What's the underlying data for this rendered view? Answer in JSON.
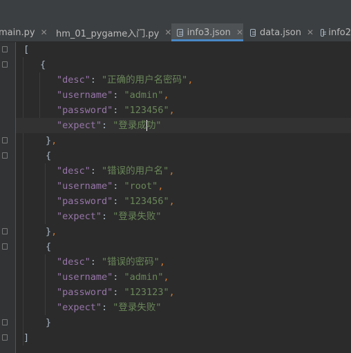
{
  "tabs": [
    {
      "label": "main.py",
      "icon": "python-file-icon",
      "active": false
    },
    {
      "label": "hm_01_pygame入门.py",
      "icon": "python-file-icon",
      "active": false
    },
    {
      "label": "info3.json",
      "icon": "json-file-icon",
      "active": true
    },
    {
      "label": "data.json",
      "icon": "json-file-icon",
      "active": false
    },
    {
      "label": "info2",
      "icon": "json-file-icon",
      "active": false
    }
  ],
  "code": {
    "records": [
      {
        "desc_key": "\"desc\"",
        "desc": "\"正确的用户名密码\"",
        "username_key": "\"username\"",
        "username": "\"admin\"",
        "password_key": "\"password\"",
        "password": "\"123456\"",
        "expect_key": "\"expect\"",
        "expect_a": "\"登录成",
        "expect_b": "功\""
      },
      {
        "desc_key": "\"desc\"",
        "desc": "\"错误的用户名\"",
        "username_key": "\"username\"",
        "username": "\"root\"",
        "password_key": "\"password\"",
        "password": "\"123456\"",
        "expect_key": "\"expect\"",
        "expect": "\"登录失败\""
      },
      {
        "desc_key": "\"desc\"",
        "desc": "\"错误的密码\"",
        "username_key": "\"username\"",
        "username": "\"admin\"",
        "password_key": "\"password\"",
        "password": "\"123123\"",
        "expect_key": "\"expect\"",
        "expect": "\"登录失败\""
      }
    ]
  },
  "colors": {
    "key": "#9876aa",
    "string": "#6a8759",
    "punctuation": "#cc7832",
    "accent": "#4a88c7"
  }
}
